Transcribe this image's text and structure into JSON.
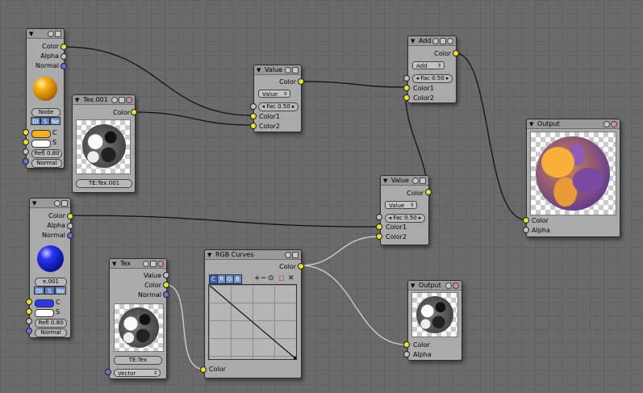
{
  "nodes": {
    "mat1": {
      "sockets": [
        "Color",
        "Alpha",
        "Normal"
      ],
      "node_label": "Node",
      "tabs": [
        "Di",
        "S",
        "Ne"
      ],
      "col_label": "C",
      "spec_label": "S",
      "refl": "Refl 0.80",
      "normal": "Normal",
      "swatch_color": "#f5b21c"
    },
    "tex001": {
      "title": "Tex.001",
      "out": "Color",
      "texture": "TE:Tex.001"
    },
    "value1": {
      "title": "Value",
      "out": "Color",
      "mode": "Value",
      "fac": "Fac 0.50",
      "in1": "Color1",
      "in2": "Color2"
    },
    "add": {
      "title": "Add",
      "out": "Color",
      "mode": "Add",
      "fac": "Fac 0.50",
      "in1": "Color1",
      "in2": "Color2"
    },
    "output1": {
      "title": "Output",
      "in1": "Color",
      "in2": "Alpha"
    },
    "mat2": {
      "sockets": [
        "Color",
        "Alpha",
        "Normal"
      ],
      "node_label": "e.001",
      "tabs": [
        "Di",
        "S",
        "Ne"
      ],
      "col_label": "C",
      "spec_label": "S",
      "refl": "Refl 0.80",
      "normal": "Normal",
      "swatch_color": "#2a35f0"
    },
    "value2": {
      "title": "Value",
      "out": "Color",
      "mode": "Value",
      "fac": "Fac 0.50",
      "in1": "Color1",
      "in2": "Color2"
    },
    "tex": {
      "title": "Tex",
      "outs": [
        "Value",
        "Color",
        "Normal"
      ],
      "texture": "TE:Tex",
      "vector": "Vector"
    },
    "curves": {
      "title": "RGB Curves",
      "out": "Color",
      "in": "Color",
      "channels": [
        "C",
        "R",
        "G",
        "B"
      ],
      "tools": [
        "+",
        "−",
        "⊙",
        "◻",
        "✕"
      ]
    },
    "output2": {
      "title": "Output",
      "in1": "Color",
      "in2": "Alpha"
    }
  },
  "colors": {
    "socket_color": "#e7df3a",
    "socket_value": "#bfbfbf",
    "socket_vector": "#6a6fd6",
    "wire": "#111111",
    "wire_light": "#d4d4d4"
  }
}
